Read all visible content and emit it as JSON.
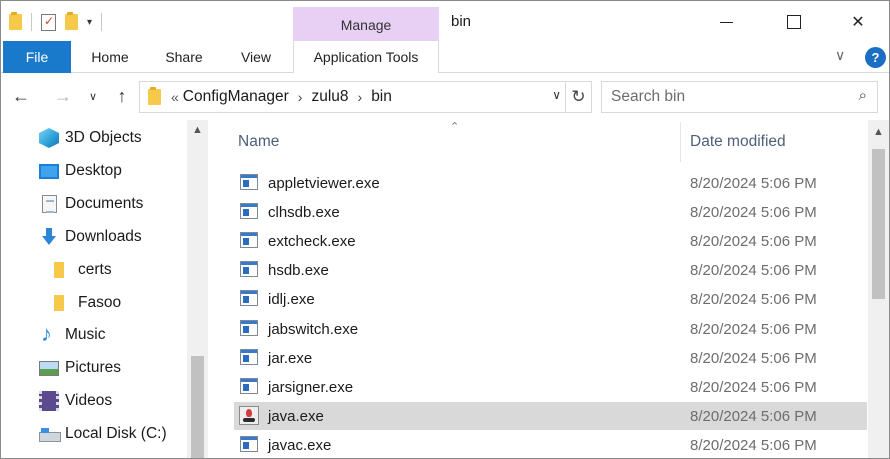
{
  "window": {
    "title": "bin",
    "contextual_tab_group": "Manage",
    "minimize": "",
    "maximize": "",
    "close": "✕"
  },
  "quick_access": {
    "dropdown": "▾"
  },
  "ribbon": {
    "tabs": [
      "File",
      "Home",
      "Share",
      "View",
      "Application Tools"
    ],
    "collapse": "∨",
    "help": "?"
  },
  "navigation": {
    "back": "←",
    "forward": "→",
    "recent": "∨",
    "up": "↑",
    "overflow": "«",
    "breadcrumb": [
      "ConfigManager",
      "zulu8",
      "bin"
    ],
    "breadcrumb_separator": "›",
    "address_dropdown": "∨",
    "refresh": "↻",
    "search_placeholder": "Search bin",
    "search_icon": "⌕"
  },
  "nav_pane": {
    "items": [
      {
        "label": "3D Objects",
        "icon": "3d-objects-icon"
      },
      {
        "label": "Desktop",
        "icon": "desktop-icon"
      },
      {
        "label": "Documents",
        "icon": "documents-icon"
      },
      {
        "label": "Downloads",
        "icon": "downloads-icon"
      },
      {
        "label": "certs",
        "icon": "folder-icon"
      },
      {
        "label": "Fasoo",
        "icon": "folder-icon"
      },
      {
        "label": "Music",
        "icon": "music-icon"
      },
      {
        "label": "Pictures",
        "icon": "pictures-icon"
      },
      {
        "label": "Videos",
        "icon": "videos-icon"
      },
      {
        "label": "Local Disk (C:)",
        "icon": "local-disk-icon"
      }
    ],
    "scroll_up": "▲"
  },
  "file_list": {
    "sort_indicator": "⌃",
    "columns": [
      "Name",
      "Date modified"
    ],
    "scroll_up": "▲",
    "rows": [
      {
        "name": "appletviewer.exe",
        "date": "8/20/2024 5:06 PM"
      },
      {
        "name": "clhsdb.exe",
        "date": "8/20/2024 5:06 PM"
      },
      {
        "name": "extcheck.exe",
        "date": "8/20/2024 5:06 PM"
      },
      {
        "name": "hsdb.exe",
        "date": "8/20/2024 5:06 PM"
      },
      {
        "name": "idlj.exe",
        "date": "8/20/2024 5:06 PM"
      },
      {
        "name": "jabswitch.exe",
        "date": "8/20/2024 5:06 PM"
      },
      {
        "name": "jar.exe",
        "date": "8/20/2024 5:06 PM"
      },
      {
        "name": "jarsigner.exe",
        "date": "8/20/2024 5:06 PM"
      },
      {
        "name": "java.exe",
        "date": "8/20/2024 5:06 PM",
        "selected": true
      },
      {
        "name": "javac.exe",
        "date": "8/20/2024 5:06 PM"
      }
    ]
  },
  "colors": {
    "file_tab": "#1979ca",
    "manage_tab": "#e8cff4",
    "selection": "#d9d9d9",
    "help": "#1a6fc4"
  }
}
